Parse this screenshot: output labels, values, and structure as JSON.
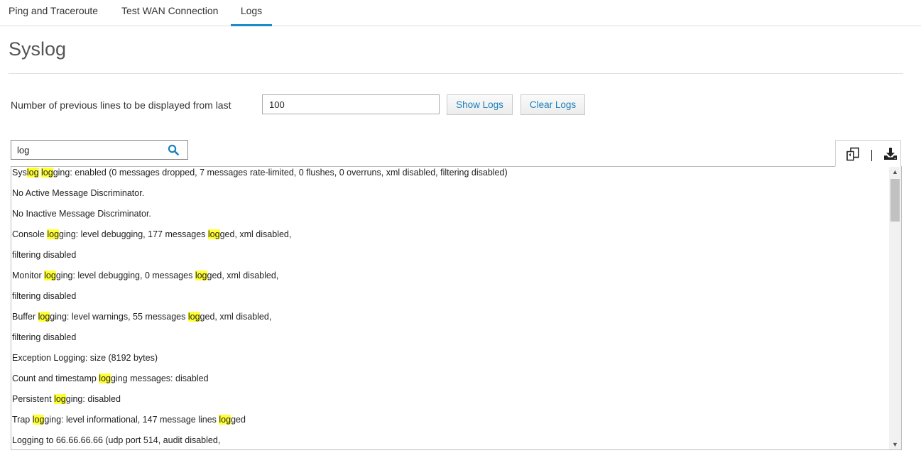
{
  "tabs": [
    {
      "label": "Ping and Traceroute",
      "active": false
    },
    {
      "label": "Test WAN Connection",
      "active": false
    },
    {
      "label": "Logs",
      "active": true
    }
  ],
  "page_title": "Syslog",
  "lines_control": {
    "label": "Number of previous lines to be displayed from last",
    "value": "100",
    "show_label": "Show Logs",
    "clear_label": "Clear Logs"
  },
  "search": {
    "value": "log",
    "icon": "search-icon"
  },
  "toolbar": {
    "copy_icon": "copy-icon",
    "download_icon": "download-icon"
  },
  "colors": {
    "accent": "#1b8cc8",
    "highlight": "#ffff33",
    "link": "#1a7fba"
  },
  "log_lines": [
    "Syslog logging: enabled (0 messages dropped, 7 messages rate-limited, 0 flushes, 0 overruns, xml disabled, filtering disabled)",
    "No Active Message Discriminator.",
    "No Inactive Message Discriminator.",
    "Console logging: level debugging, 177 messages logged, xml disabled,",
    "filtering disabled",
    "Monitor logging: level debugging, 0 messages logged, xml disabled,",
    "filtering disabled",
    "Buffer logging: level warnings, 55 messages logged, xml disabled,",
    "filtering disabled",
    "Exception Logging: size (8192 bytes)",
    "Count and timestamp logging messages: disabled",
    "Persistent logging: disabled",
    "Trap logging: level informational, 147 message lines logged",
    "Logging to 66.66.66.66 (udp port 514, audit disabled,"
  ]
}
